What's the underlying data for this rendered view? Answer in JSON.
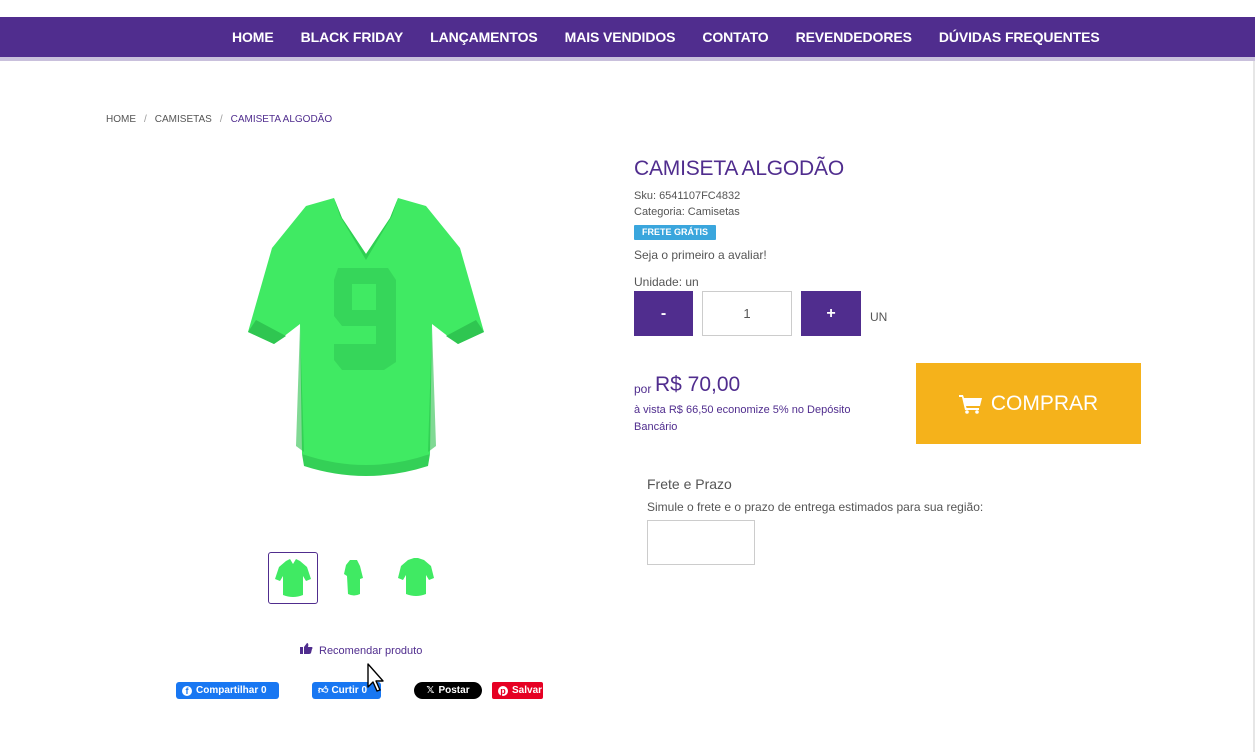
{
  "nav": {
    "items": [
      "HOME",
      "BLACK FRIDAY",
      "LANÇAMENTOS",
      "MAIS VENDIDOS",
      "CONTATO",
      "REVENDEDORES",
      "DÚVIDAS FREQUENTES"
    ]
  },
  "breadcrumb": {
    "items": [
      "HOME",
      "CAMISETAS",
      "CAMISETA ALGODÃO"
    ],
    "separator": "/"
  },
  "product": {
    "title": "CAMISETA ALGODÃO",
    "sku": "Sku: 6541107FC4832",
    "category": "Categoria: Camisetas",
    "badge": "FRETE GRÁTIS",
    "review_prompt": "Seja o primeiro a avaliar!",
    "unit_label": "Unidade: un",
    "color": "#33e65a"
  },
  "quantity": {
    "minus": "-",
    "value": "1",
    "plus": "+",
    "unit": "UN"
  },
  "price": {
    "prefix": "por",
    "value": "R$ 70,00",
    "cash_line": "à vista R$ 66,50 economize 5% no Depósito Bancário"
  },
  "buy": {
    "label": "COMPRAR",
    "icon": "cart-icon",
    "color": "#f5b21b"
  },
  "shipping": {
    "title": "Frete e Prazo",
    "description": "Simule o frete e o prazo de entrega estimados para sua região:",
    "cep_value": ""
  },
  "recommend": {
    "label": "Recomendar produto",
    "icon": "thumbs-up-icon"
  },
  "social": {
    "facebook_share": "Compartilhar 0",
    "facebook_like": "Curtir 0",
    "x_post": "Postar",
    "pinterest": "Salvar"
  },
  "theme": {
    "primary": "#502d8e",
    "badge": "#3aa6dd"
  }
}
